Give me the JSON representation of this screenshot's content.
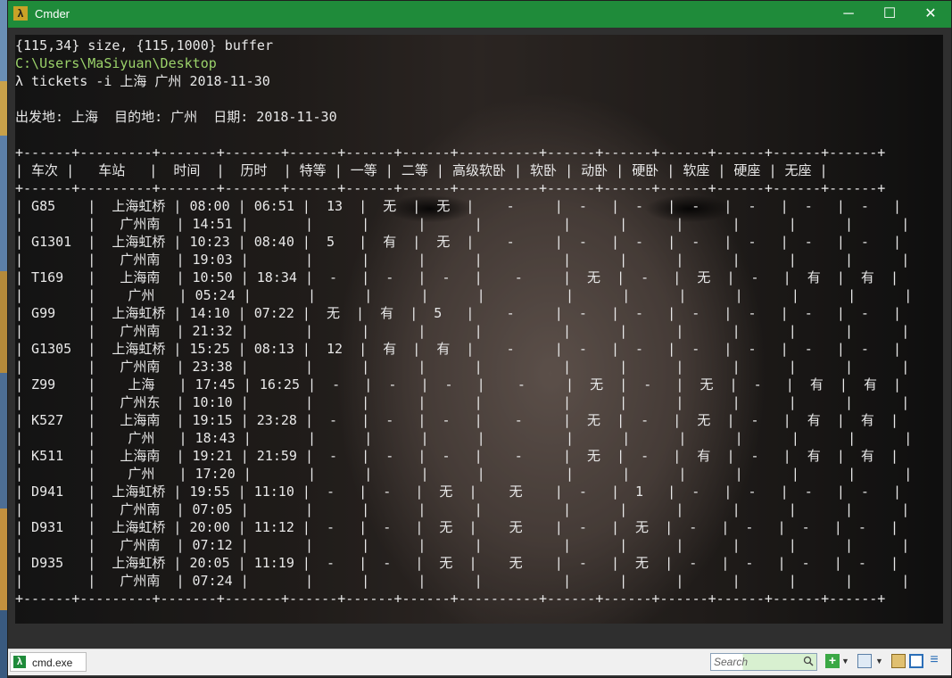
{
  "window": {
    "title": "Cmder"
  },
  "titlebar": {
    "icon": "λ",
    "minimize": "─",
    "maximize": "☐",
    "close": "✕"
  },
  "terminal": {
    "lines": [
      "{115,34} size, {115,1000} buffer",
      "C:\\Users\\MaSiyuan\\Desktop",
      "λ tickets -i 上海 广州 2018-11-30",
      "",
      "出发地: 上海  目的地: 广州  日期: 2018-11-30"
    ]
  },
  "table": {
    "border": "+------+---------+-------+-------+------+------+------+----------+------+------+------+------+------+------+",
    "header": "| 车次 |   车站   |  时间  |  历时  | 特等 | 一等 | 二等 | 高级软卧 | 软卧 | 动卧 | 硬卧 | 软座 | 硬座 | 无座 |",
    "rows": [
      [
        "| G85    |  上海虹桥 | 08:00 | 06:51 |  13  |  无  |  无  |    -     |  -   |  -   |  -   |  -   |  -   |  -   |",
        "|        |   广州南  | 14:51 |       |      |      |      |          |      |      |      |      |      |      |"
      ],
      [
        "| G1301  |  上海虹桥 | 10:23 | 08:40 |  5   |  有  |  无  |    -     |  -   |  -   |  -   |  -   |  -   |  -   |",
        "|        |   广州南  | 19:03 |       |      |      |      |          |      |      |      |      |      |      |"
      ],
      [
        "| T169   |   上海南  | 10:50 | 18:34 |  -   |  -   |  -   |    -     |  无  |  -   |  无  |  -   |  有  |  有  |",
        "|        |    广州   | 05:24 |       |      |      |      |          |      |      |      |      |      |      |"
      ],
      [
        "| G99    |  上海虹桥 | 14:10 | 07:22 |  无  |  有  |  5   |    -     |  -   |  -   |  -   |  -   |  -   |  -   |",
        "|        |   广州南  | 21:32 |       |      |      |      |          |      |      |      |      |      |      |"
      ],
      [
        "| G1305  |  上海虹桥 | 15:25 | 08:13 |  12  |  有  |  有  |    -     |  -   |  -   |  -   |  -   |  -   |  -   |",
        "|        |   广州南  | 23:38 |       |      |      |      |          |      |      |      |      |      |      |"
      ],
      [
        "| Z99    |    上海   | 17:45 | 16:25 |  -   |  -   |  -   |    -     |  无  |  -   |  无  |  -   |  有  |  有  |",
        "|        |   广州东  | 10:10 |       |      |      |      |          |      |      |      |      |      |      |"
      ],
      [
        "| K527   |   上海南  | 19:15 | 23:28 |  -   |  -   |  -   |    -     |  无  |  -   |  无  |  -   |  有  |  有  |",
        "|        |    广州   | 18:43 |       |      |      |      |          |      |      |      |      |      |      |"
      ],
      [
        "| K511   |   上海南  | 19:21 | 21:59 |  -   |  -   |  -   |    -     |  无  |  -   |  有  |  -   |  有  |  有  |",
        "|        |    广州   | 17:20 |       |      |      |      |          |      |      |      |      |      |      |"
      ],
      [
        "| D941   |  上海虹桥 | 19:55 | 11:10 |  -   |  -   |  无  |    无    |  -   |  1   |  -   |  -   |  -   |  -   |",
        "|        |   广州南  | 07:05 |       |      |      |      |          |      |      |      |      |      |      |"
      ],
      [
        "| D931   |  上海虹桥 | 20:00 | 11:12 |  -   |  -   |  无  |    无    |  -   |  无  |  -   |  -   |  -   |  -   |",
        "|        |   广州南  | 07:12 |       |      |      |      |          |      |      |      |      |      |      |"
      ],
      [
        "| D935   |  上海虹桥 | 20:05 | 11:19 |  -   |  -   |  无  |    无    |  -   |  无  |  -   |  -   |  -   |  -   |",
        "|        |   广州南  | 07:24 |       |      |      |      |          |      |      |      |      |      |      |"
      ]
    ]
  },
  "tabbar": {
    "tab_icon": "λ",
    "tab_label": "cmd.exe",
    "search_placeholder": "Search",
    "add_icon": "+",
    "dropdown_icon": "▼",
    "menu_icon": "≡"
  }
}
